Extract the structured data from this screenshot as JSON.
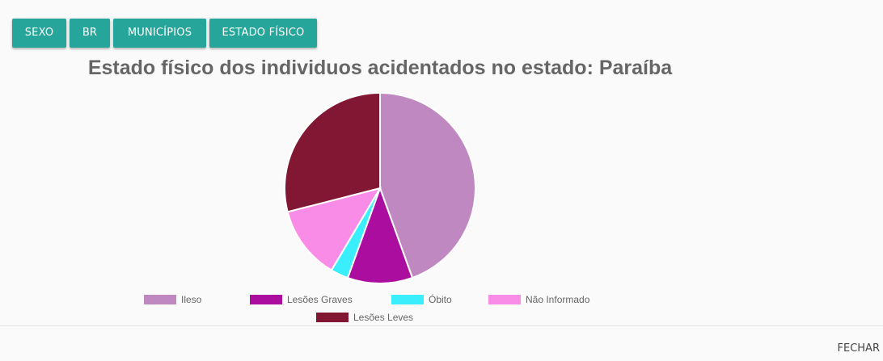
{
  "tabs": [
    {
      "label": "SEXO"
    },
    {
      "label": "BR"
    },
    {
      "label": "MUNICÍPIOS"
    },
    {
      "label": "ESTADO FÍSICO"
    }
  ],
  "footer": {
    "close_label": "FECHAR"
  },
  "chart_data": {
    "type": "pie",
    "title": "Estado físico dos individuos acidentados no estado: Paraíba",
    "slices": [
      {
        "label": "Ileso",
        "value": 44.5,
        "color": "#bf88c1"
      },
      {
        "label": "Lesões Graves",
        "value": 11.0,
        "color": "#ab0e9e"
      },
      {
        "label": "Óbito",
        "value": 3.0,
        "color": "#3aeefc"
      },
      {
        "label": "Não Informado",
        "value": 12.5,
        "color": "#f98ce6"
      },
      {
        "label": "Lesões Leves",
        "value": 29.0,
        "color": "#821734"
      }
    ],
    "legend_position": "bottom"
  }
}
